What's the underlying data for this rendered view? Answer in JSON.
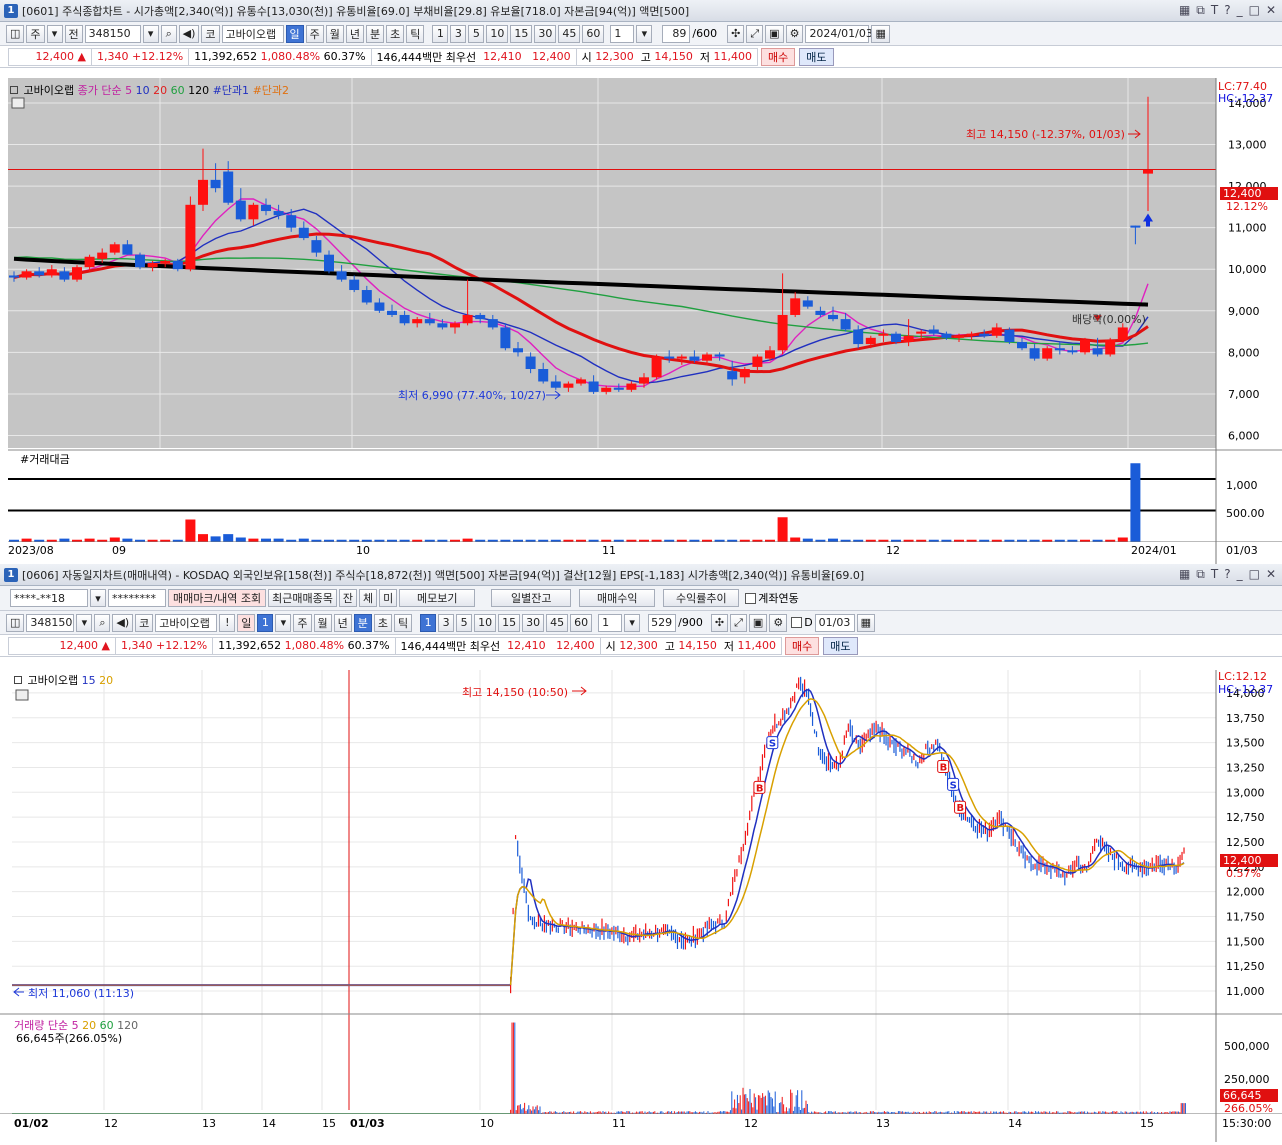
{
  "top": {
    "title": {
      "num": "1",
      "text": "[0601] 주식종합차트 - 시가총액[2,340(억)] 유통수[13,030(천)] 유통비율[69.0] 부채비율[29.8] 유보율[718.0] 자본금[94(억)] 액면[500]"
    },
    "toolbar": {
      "market": "주",
      "prev": "전",
      "code": "348150",
      "stock_flag": "코",
      "stock_name": "고바이오랩",
      "periods": [
        "일",
        "주",
        "월",
        "년",
        "분",
        "초",
        "틱"
      ],
      "intervals": [
        "1",
        "3",
        "5",
        "10",
        "15",
        "30",
        "45",
        "60"
      ],
      "count_sel": "1",
      "count": "89",
      "count_max": "/600",
      "date": "2024/01/03"
    },
    "quote": {
      "price": "12,400",
      "change": "1,340",
      "change_pct": "+12.12%",
      "volume": "11,392,652",
      "vol_ratio": "1,080.48%",
      "turnover": "60.37%",
      "amount": "146,444백만",
      "best_label": "최우선",
      "best_ask": "12,410",
      "best_bid": "12,400",
      "open_label": "시",
      "open": "12,300",
      "high_label": "고",
      "high": "14,150",
      "low_label": "저",
      "low": "11,400",
      "buy": "매수",
      "sell": "매도"
    },
    "legend": {
      "name": "고바이오랩",
      "ma": "종가 단순",
      "p5": "5",
      "p10": "10",
      "p20": "20",
      "p60": "60",
      "p120": "120",
      "d1": "#단과1",
      "d2": "#단과2"
    },
    "lc": "LC:77.40",
    "hc": "HC:-12.37",
    "annotations": {
      "high": "최고 14,150 (-12.37%, 01/03)",
      "low": "최저 6,990 (77.40%, 10/27)",
      "dividend": "배당락(0.00%)"
    },
    "current_tag": "12,400",
    "current_pct": "12.12%",
    "vol_legend": "#거래대금",
    "vol_axis": [
      "1,000",
      "500.00"
    ],
    "date_axis": [
      "2023/08",
      "09",
      "10",
      "11",
      "12",
      "2024/01",
      "01/03"
    ]
  },
  "bottom": {
    "title": {
      "num": "1",
      "text": "[0606] 자동일지차트(매매내역) - KOSDAQ 외국인보유[158(천)] 주식수[18,872(천)] 액면[500] 자본금[94(억)] 결산[12월] EPS[-1,183] 시가총액[2,340(억)] 유통비율[69.0]"
    },
    "toolbar1": {
      "account": "****-**18",
      "password": "********",
      "b1": "매매마크/내역 조회",
      "b2": "최근매매종목",
      "b3": "잔",
      "b4": "체",
      "b5": "미",
      "b6": "메모보기",
      "b7": "일별잔고",
      "b8": "매매수익",
      "b9": "수익률추이",
      "chk": "계좌연동"
    },
    "toolbar2": {
      "code": "348150",
      "stock_flag": "코",
      "stock_name": "고바이오랩",
      "excl": "!",
      "day": "일",
      "day_n": "1",
      "periods": [
        "주",
        "월",
        "년",
        "분",
        "초",
        "틱"
      ],
      "intervals": [
        "1",
        "3",
        "5",
        "10",
        "15",
        "30",
        "45",
        "60"
      ],
      "count_sel": "1",
      "count": "529",
      "count_max": "/900",
      "d_label": "D",
      "date": "01/03"
    },
    "legend": {
      "name": "고바이오랩",
      "p15": "15",
      "p20": "20"
    },
    "lc": "LC:12.12",
    "hc": "HC:-12.37",
    "annotations": {
      "high": "최고 14,150 (10:50)",
      "low": "최저 11,060 (11:13)"
    },
    "current_tag": "12,400",
    "current_pct": "0.57%",
    "vol_legend": {
      "label": "거래량",
      "ma": "단순",
      "p5": "5",
      "p20": "20",
      "p60": "60",
      "p120": "120"
    },
    "vol_value": "66,645주(266.05%)",
    "vol_axis": [
      "500,000",
      "250,000"
    ],
    "vol_tag": "66,645",
    "vol_tag_pct": "266.05%",
    "time_axis": [
      "01/02",
      "12",
      "13",
      "14",
      "15",
      "01/03",
      "10",
      "11",
      "12",
      "13",
      "14",
      "15"
    ],
    "clock": "15:30:00"
  },
  "chart_data": [
    {
      "type": "candlestick",
      "title": "고바이오랩 일봉",
      "ylim": [
        5700,
        14600
      ],
      "y_ticks": [
        14000,
        13000,
        12000,
        11000,
        10000,
        9000,
        8000,
        7000,
        6000
      ],
      "x_ticks": [
        "2023/08",
        "09",
        "10",
        "11",
        "12",
        "2024/01",
        "01/03"
      ],
      "candles": [
        [
          9850,
          9950,
          9700,
          9800
        ],
        [
          9800,
          10000,
          9750,
          9950
        ],
        [
          9950,
          10050,
          9800,
          9850
        ],
        [
          9850,
          10100,
          9800,
          10000
        ],
        [
          9950,
          10050,
          9700,
          9750
        ],
        [
          9750,
          10100,
          9700,
          10050
        ],
        [
          10050,
          10350,
          9950,
          10300
        ],
        [
          10250,
          10500,
          10150,
          10400
        ],
        [
          10400,
          10650,
          10350,
          10600
        ],
        [
          10600,
          10700,
          10350,
          10350
        ],
        [
          10350,
          10400,
          10000,
          10050
        ],
        [
          10050,
          10200,
          9950,
          10150
        ],
        [
          10150,
          10250,
          10050,
          10200
        ],
        [
          10200,
          10250,
          9950,
          10000
        ],
        [
          10000,
          11750,
          9950,
          11550
        ],
        [
          11550,
          12900,
          11400,
          12150
        ],
        [
          12150,
          12550,
          11850,
          11950
        ],
        [
          12350,
          12600,
          11550,
          11600
        ],
        [
          11650,
          11950,
          11150,
          11200
        ],
        [
          11200,
          11600,
          11050,
          11550
        ],
        [
          11550,
          11700,
          11300,
          11400
        ],
        [
          11400,
          11550,
          11200,
          11300
        ],
        [
          11300,
          11450,
          10900,
          11000
        ],
        [
          11000,
          11150,
          10700,
          10750
        ],
        [
          10700,
          10800,
          10300,
          10400
        ],
        [
          10350,
          10450,
          9900,
          9950
        ],
        [
          9950,
          10100,
          9700,
          9750
        ],
        [
          9750,
          9850,
          9450,
          9500
        ],
        [
          9500,
          9600,
          9150,
          9200
        ],
        [
          9200,
          9300,
          8950,
          9000
        ],
        [
          9000,
          9150,
          8850,
          8900
        ],
        [
          8900,
          9000,
          8650,
          8700
        ],
        [
          8700,
          8850,
          8600,
          8800
        ],
        [
          8800,
          8950,
          8650,
          8700
        ],
        [
          8700,
          8800,
          8550,
          8600
        ],
        [
          8600,
          8750,
          8450,
          8700
        ],
        [
          8700,
          9750,
          8650,
          8900
        ],
        [
          8900,
          8950,
          8700,
          8800
        ],
        [
          8800,
          8900,
          8550,
          8600
        ],
        [
          8600,
          8700,
          8050,
          8100
        ],
        [
          8100,
          8250,
          7900,
          8000
        ],
        [
          7900,
          8000,
          7500,
          7600
        ],
        [
          7600,
          7750,
          7250,
          7300
        ],
        [
          7300,
          7450,
          7100,
          7150
        ],
        [
          7150,
          7300,
          7050,
          7250
        ],
        [
          7250,
          7400,
          7200,
          7350
        ],
        [
          7300,
          7450,
          7000,
          7050
        ],
        [
          7050,
          7200,
          6990,
          7150
        ],
        [
          7150,
          7250,
          7050,
          7100
        ],
        [
          7100,
          7300,
          7050,
          7250
        ],
        [
          7250,
          7500,
          7150,
          7400
        ],
        [
          7400,
          7950,
          7350,
          7900
        ],
        [
          7900,
          8050,
          7750,
          7850
        ],
        [
          7850,
          7950,
          7700,
          7900
        ],
        [
          7900,
          8050,
          7750,
          7800
        ],
        [
          7800,
          8000,
          7700,
          7950
        ],
        [
          7950,
          8000,
          7800,
          7900
        ],
        [
          7550,
          7800,
          7200,
          7350
        ],
        [
          7400,
          7650,
          7250,
          7600
        ],
        [
          7650,
          7950,
          7550,
          7900
        ],
        [
          7850,
          8150,
          7800,
          8050
        ],
        [
          8050,
          9900,
          7950,
          8900
        ],
        [
          8900,
          9450,
          8850,
          9300
        ],
        [
          9250,
          9350,
          9050,
          9100
        ],
        [
          9000,
          9100,
          8850,
          8900
        ],
        [
          8900,
          9100,
          8750,
          8800
        ],
        [
          8800,
          8950,
          8500,
          8550
        ],
        [
          8550,
          8650,
          8100,
          8200
        ],
        [
          8200,
          8400,
          8100,
          8350
        ],
        [
          8400,
          8550,
          8250,
          8450
        ],
        [
          8450,
          8500,
          8200,
          8250
        ],
        [
          8250,
          8800,
          8150,
          8400
        ],
        [
          8450,
          8550,
          8300,
          8500
        ],
        [
          8550,
          8650,
          8400,
          8450
        ],
        [
          8450,
          8500,
          8300,
          8350
        ],
        [
          8350,
          8450,
          8250,
          8400
        ],
        [
          8400,
          8500,
          8300,
          8450
        ],
        [
          8450,
          8550,
          8350,
          8400
        ],
        [
          8400,
          8700,
          8350,
          8600
        ],
        [
          8550,
          8600,
          8200,
          8250
        ],
        [
          8250,
          8350,
          8050,
          8100
        ],
        [
          8100,
          8200,
          7800,
          7850
        ],
        [
          7850,
          8150,
          7800,
          8100
        ],
        [
          8100,
          8250,
          7950,
          8050
        ],
        [
          8050,
          8150,
          7950,
          8000
        ],
        [
          8000,
          8350,
          7950,
          8300
        ],
        [
          8100,
          8350,
          7900,
          7950
        ],
        [
          7950,
          8350,
          7900,
          8300
        ],
        [
          8300,
          8700,
          8250,
          8600
        ],
        [
          11050,
          11050,
          10600,
          11000
        ],
        [
          12300,
          14150,
          11400,
          12400
        ]
      ]
    },
    {
      "type": "bar",
      "title": "#거래대금",
      "values": [
        2,
        3,
        2,
        2,
        3,
        2,
        3,
        2,
        4,
        3,
        2,
        2,
        2,
        2,
        20,
        7,
        5,
        7,
        4,
        3,
        3,
        3,
        2,
        3,
        2,
        2,
        2,
        2,
        2,
        2,
        2,
        2,
        2,
        2,
        2,
        2,
        3,
        2,
        2,
        2,
        2,
        2,
        2,
        2,
        2,
        2,
        2,
        2,
        2,
        2,
        2,
        2,
        2,
        2,
        2,
        2,
        2,
        2,
        2,
        2,
        2,
        22,
        4,
        3,
        2,
        3,
        2,
        2,
        2,
        2,
        2,
        2,
        2,
        2,
        2,
        2,
        2,
        2,
        2,
        2,
        2,
        2,
        2,
        2,
        2,
        2,
        2,
        2,
        4,
        70
      ],
      "ylim": [
        0,
        80
      ]
    },
    {
      "type": "line",
      "title": "고바이오랩 분봉",
      "ylim": [
        10950,
        14150
      ],
      "y_ticks": [
        14000,
        13750,
        13500,
        13250,
        13000,
        12750,
        12500,
        12250,
        12000,
        11750,
        11500,
        11250,
        11000
      ],
      "x_ticks": [
        "01/02",
        "12",
        "13",
        "14",
        "15",
        "01/03",
        "10",
        "11",
        "12",
        "13",
        "14",
        "15"
      ],
      "series": [
        {
          "name": "price",
          "points": [
            [
              0,
              11060
            ],
            [
              0.5,
              11060
            ],
            [
              0.505,
              12550
            ],
            [
              0.52,
              11700
            ],
            [
              0.55,
              11650
            ],
            [
              0.6,
              11600
            ],
            [
              0.62,
              11550
            ],
            [
              0.65,
              11600
            ],
            [
              0.68,
              11500
            ],
            [
              0.7,
              11650
            ],
            [
              0.715,
              11700
            ],
            [
              0.73,
              12300
            ],
            [
              0.745,
              12950
            ],
            [
              0.76,
              13600
            ],
            [
              0.78,
              13850
            ],
            [
              0.79,
              14100
            ],
            [
              0.8,
              13950
            ],
            [
              0.81,
              13450
            ],
            [
              0.82,
              13300
            ],
            [
              0.83,
              13250
            ],
            [
              0.84,
              13650
            ],
            [
              0.85,
              13450
            ],
            [
              0.86,
              13550
            ],
            [
              0.87,
              13650
            ],
            [
              0.88,
              13500
            ],
            [
              0.9,
              13400
            ],
            [
              0.91,
              13300
            ],
            [
              0.92,
              13450
            ],
            [
              0.93,
              13500
            ],
            [
              0.94,
              13150
            ],
            [
              0.95,
              12850
            ],
            [
              0.96,
              12750
            ],
            [
              0.97,
              12650
            ],
            [
              0.98,
              12600
            ],
            [
              0.99,
              12750
            ],
            [
              1.0,
              12650
            ],
            [
              1.01,
              12450
            ],
            [
              1.02,
              12300
            ],
            [
              1.04,
              12250
            ],
            [
              1.05,
              12200
            ],
            [
              1.06,
              12150
            ],
            [
              1.07,
              12300
            ],
            [
              1.08,
              12200
            ],
            [
              1.09,
              12550
            ],
            [
              1.1,
              12400
            ],
            [
              1.12,
              12250
            ],
            [
              1.14,
              12250
            ],
            [
              1.16,
              12300
            ],
            [
              1.17,
              12260
            ],
            [
              1.18,
              12400
            ]
          ]
        }
      ]
    },
    {
      "type": "bar",
      "title": "거래량",
      "ylim": [
        0,
        600000
      ]
    }
  ]
}
